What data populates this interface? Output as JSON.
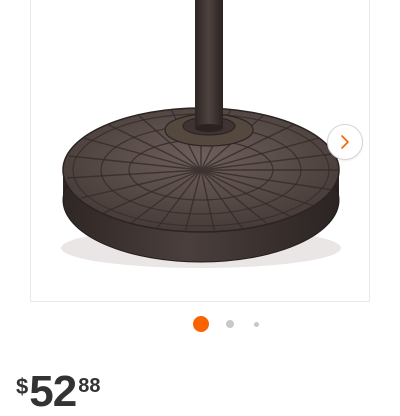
{
  "gallery": {
    "image_alt": "umbrella base",
    "next_icon": "chevron-right-icon",
    "dots": [
      {
        "state": "active",
        "color": "#f96302"
      },
      {
        "state": "inactive",
        "color": "#c8c8c8"
      },
      {
        "state": "inactive",
        "color": "#c8c8c8"
      }
    ]
  },
  "price": {
    "currency": "$",
    "dollars": "52",
    "cents": "88"
  }
}
